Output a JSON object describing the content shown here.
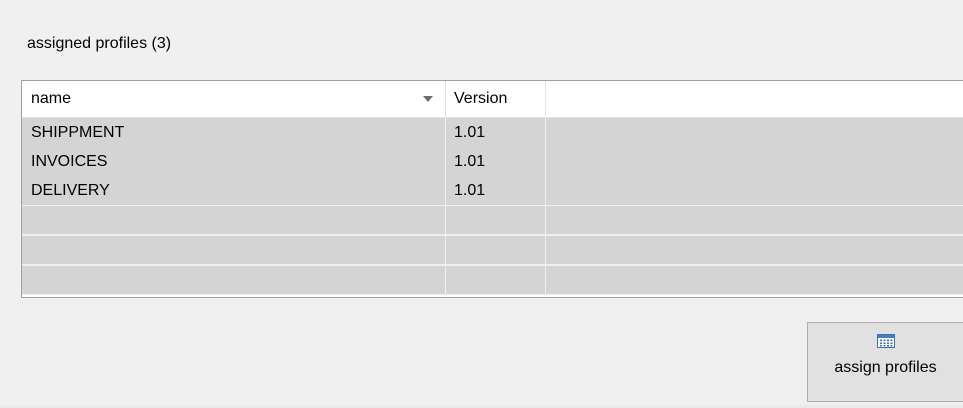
{
  "group": {
    "title": "assigned profiles (3)"
  },
  "grid": {
    "columns": [
      {
        "label": "name",
        "sort_icon": "sort-descending-icon"
      },
      {
        "label": "Version"
      }
    ],
    "rows": [
      {
        "name": "SHIPPMENT",
        "version": "1.01"
      },
      {
        "name": "INVOICES",
        "version": "1.01"
      },
      {
        "name": "DELIVERY",
        "version": "1.01"
      }
    ],
    "empty_rows": 3,
    "colors": {
      "row_background": "#d4d4d4",
      "header_background": "#ffffff"
    }
  },
  "actions": {
    "assign_label": "assign profiles",
    "assign_icon": "grid-table-icon"
  }
}
